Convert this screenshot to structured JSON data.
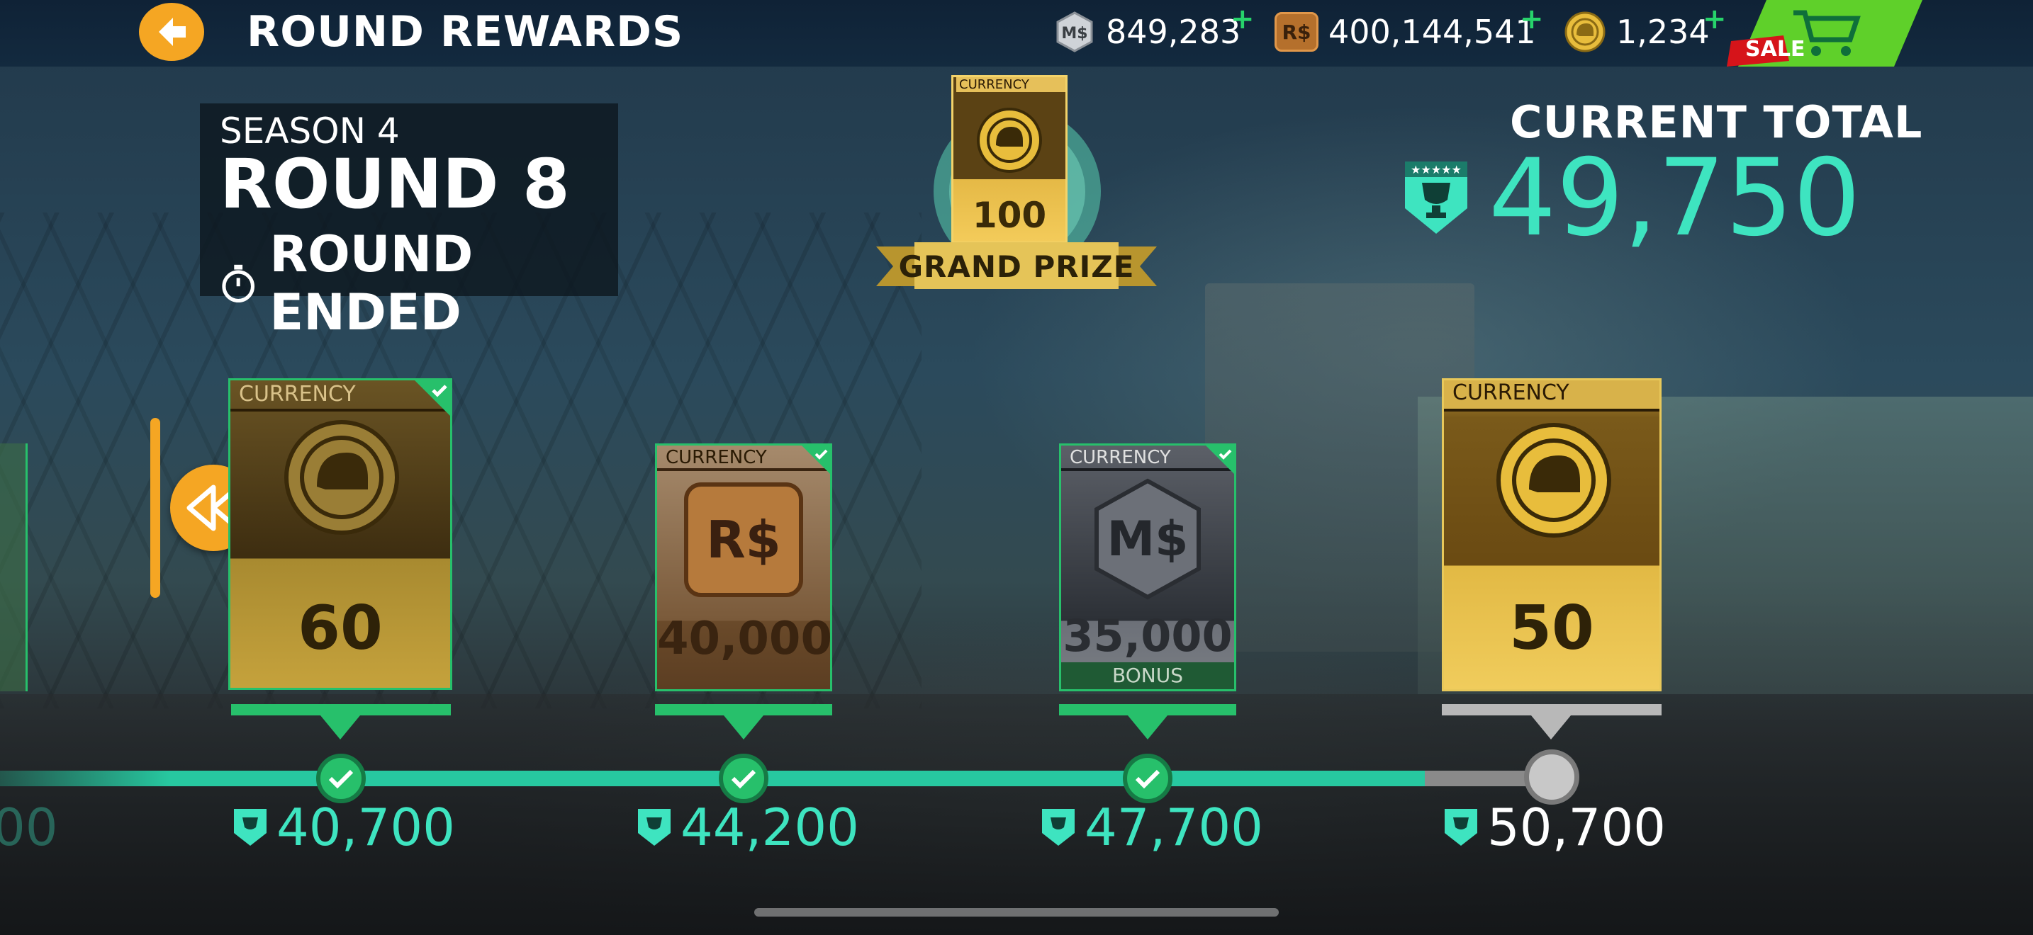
{
  "header": {
    "title": "ROUND REWARDS",
    "currencies": [
      {
        "icon": "ms-currency-icon",
        "value": "849,283"
      },
      {
        "icon": "rs-currency-icon",
        "value": "400,144,541"
      },
      {
        "icon": "gold-helmet-coin-icon",
        "value": "1,234"
      }
    ],
    "plus": "+",
    "sale_label": "SALE",
    "rs_symbol": "R$"
  },
  "season": {
    "season_label": "SEASON 4",
    "round_label": "ROUND 8",
    "status": "ROUND ENDED"
  },
  "grand_prize": {
    "tag": "CURRENCY",
    "amount": "100",
    "label": "GRAND PRIZE"
  },
  "current_total": {
    "label": "CURRENT TOTAL",
    "value": "49,750"
  },
  "rewards": [
    {
      "tag": "CURRENCY",
      "amount": "60",
      "type": "gold",
      "claimed": true,
      "threshold": "40,700"
    },
    {
      "tag": "CURRENCY",
      "amount": "40,000",
      "type": "rs",
      "claimed": true,
      "threshold": "44,200",
      "symbol": "R$"
    },
    {
      "tag": "CURRENCY",
      "amount": "35,000",
      "type": "ms",
      "claimed": true,
      "threshold": "47,700",
      "symbol": "M$",
      "extra": "BONUS"
    },
    {
      "tag": "CURRENCY",
      "amount": "50",
      "type": "gold",
      "claimed": false,
      "threshold": "50,700"
    }
  ],
  "prev_threshold_partial": "00",
  "colors": {
    "accent_teal": "#3ee4c0",
    "claimed_green": "#27c06b",
    "orange": "#f5a623",
    "gold": "#e5b946"
  }
}
